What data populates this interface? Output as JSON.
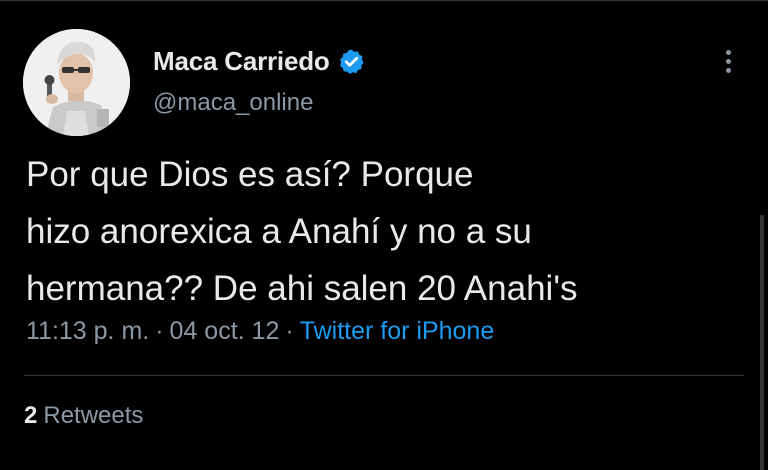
{
  "author": {
    "display_name": "Maca Carriedo",
    "handle": "@maca_online",
    "verified": true,
    "avatar": "profile-photo"
  },
  "tweet": {
    "text_lines": [
      "Por que Dios es así? Porque",
      "hizo anorexica a Anahí y no a su",
      "hermana?? De ahi salen 20 Anahi's"
    ],
    "time": "11:13 p. m.",
    "separator": "·",
    "date": "04 oct. 12",
    "source": "Twitter for iPhone"
  },
  "stats": {
    "retweets_count": "2",
    "retweets_label": "Retweets"
  },
  "icons": {
    "verified": "verified-badge-icon",
    "more": "more-vertical-icon"
  },
  "colors": {
    "background": "#000000",
    "primary_text": "#e7e9ea",
    "secondary_text": "#8b98a5",
    "accent": "#1d9bf0",
    "divider": "#2f3336"
  }
}
